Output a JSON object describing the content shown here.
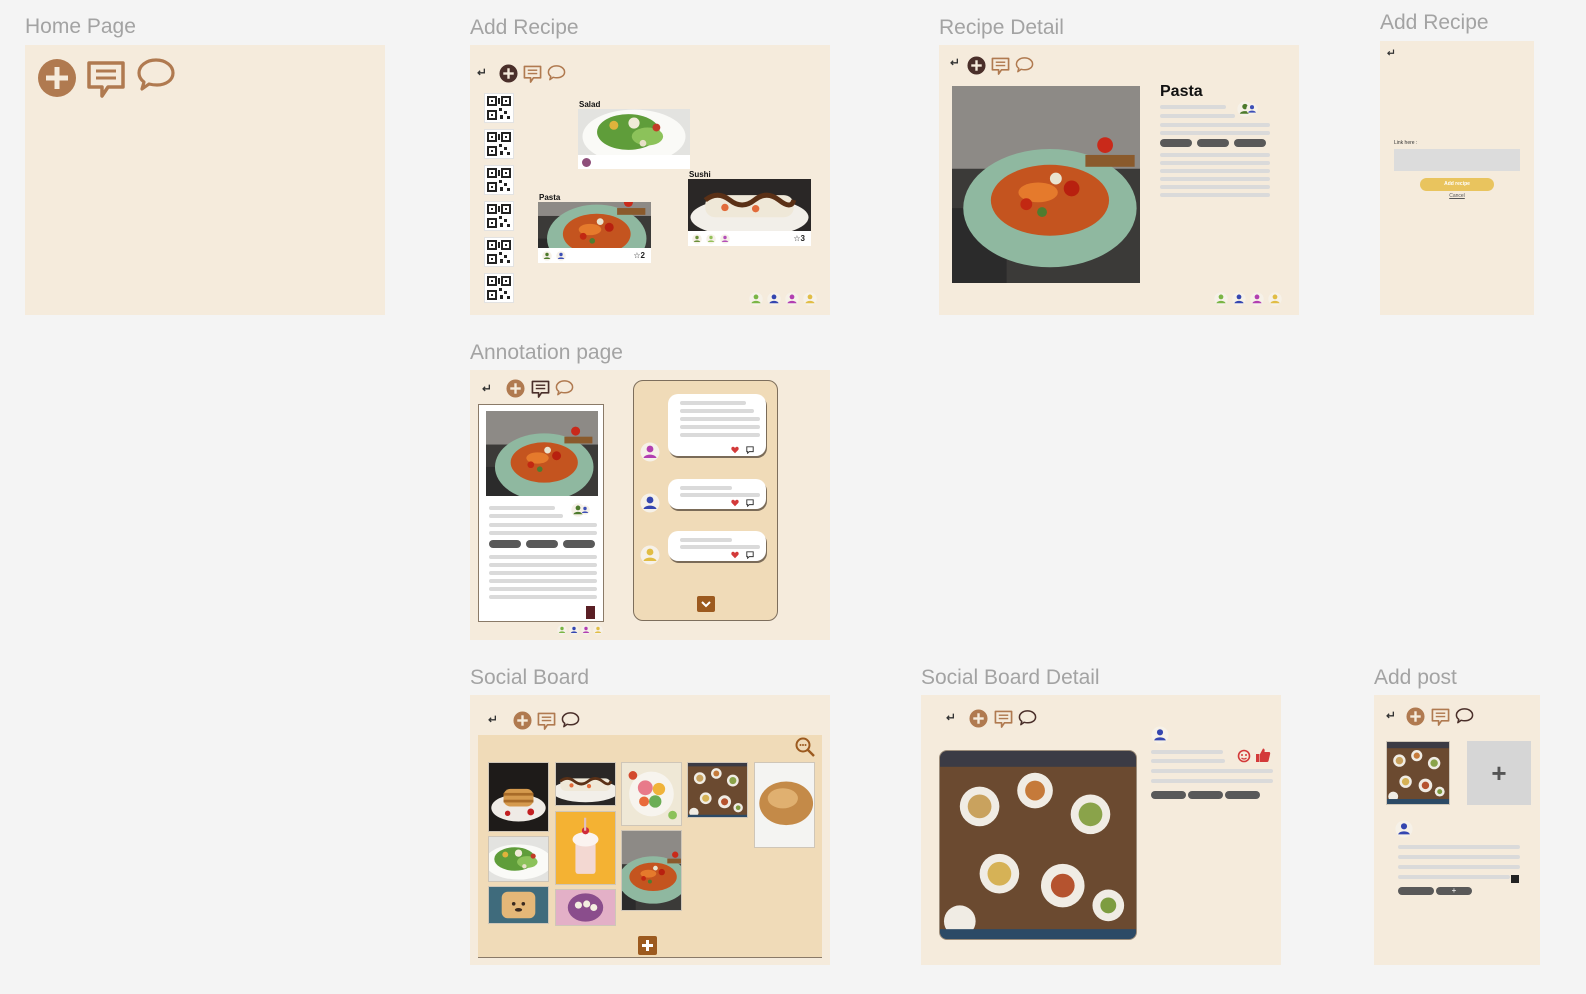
{
  "frames": {
    "home": {
      "title": "Home Page"
    },
    "add_recipe": {
      "title": "Add Recipe",
      "cards": [
        {
          "label": "Salad"
        },
        {
          "label": "Sushi",
          "rating": "☆3"
        },
        {
          "label": "Pasta",
          "rating": "☆2"
        }
      ]
    },
    "recipe_detail": {
      "title": "Recipe Detail",
      "recipe_name": "Pasta"
    },
    "add_recipe_form": {
      "title": "Add Recipe",
      "link_label": "Link here :",
      "submit_label": "Add recipe",
      "cancel_label": "Cancel"
    },
    "annotation": {
      "title": "Annotation page"
    },
    "social_board": {
      "title": "Social Board"
    },
    "social_board_detail": {
      "title": "Social Board Detail"
    },
    "add_post": {
      "title": "Add post",
      "add_symbol": "+"
    }
  },
  "icons": {
    "back": "back-arrow-icon",
    "add": "plus-circle-icon",
    "notes": "notes-icon",
    "chat": "chat-bubble-icon",
    "zoom": "zoom-icon",
    "heart": "heart-icon",
    "comment": "comment-icon"
  },
  "colors": {
    "canvas": "#f4f4f4",
    "frame_bg": "#f5ebdc",
    "panel_bg": "#f0dbb8",
    "icon_brown": "#b07a50",
    "icon_dark": "#4a2f2a",
    "accent_yellow": "#e9c45e",
    "pill_gray": "#595959",
    "line_gray": "#dadada"
  }
}
